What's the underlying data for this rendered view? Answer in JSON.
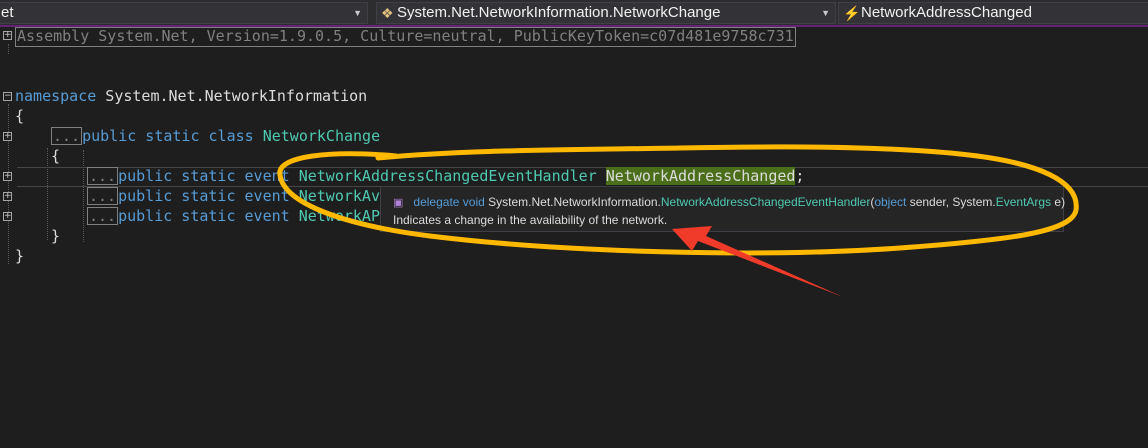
{
  "nav": {
    "project": "et",
    "type": "System.Net.NetworkInformation.NetworkChange",
    "member": "NetworkAddressChanged"
  },
  "code": {
    "assembly": "Assembly System.Net, Version=1.9.0.5, Culture=neutral, PublicKeyToken=c07d481e9758c731",
    "ns_kw": "namespace",
    "ns_name": " System.Net.NetworkInformation",
    "open_brace": "{",
    "close_brace": "}",
    "dots": "...",
    "class_mods": "public static class ",
    "class_name": "NetworkChange",
    "event_mods": "public static event ",
    "line1_type": "NetworkAddressChangedEventHandler",
    "line1_name": "NetworkAddressChanged",
    "semicolon": ";",
    "line2_type": "NetworkAva",
    "line3_type": "NetworkAPS"
  },
  "tooltip": {
    "kw": "delegate void",
    "ns": " System.Net.NetworkInformation.",
    "type": "NetworkAddressChangedEventHandler",
    "paren_open": "(",
    "p1_type": "object",
    "p1_name": " sender, System.",
    "p2_type": "EventArgs",
    "p2_name": " e)",
    "description": "Indicates a change in the availability of the network."
  },
  "colors": {
    "keyword": "#569cd6",
    "type": "#4ec9b0",
    "highlight": "#4b6e1a",
    "annotation_ellipse": "#ffb800",
    "annotation_arrow": "#f03a2a"
  }
}
